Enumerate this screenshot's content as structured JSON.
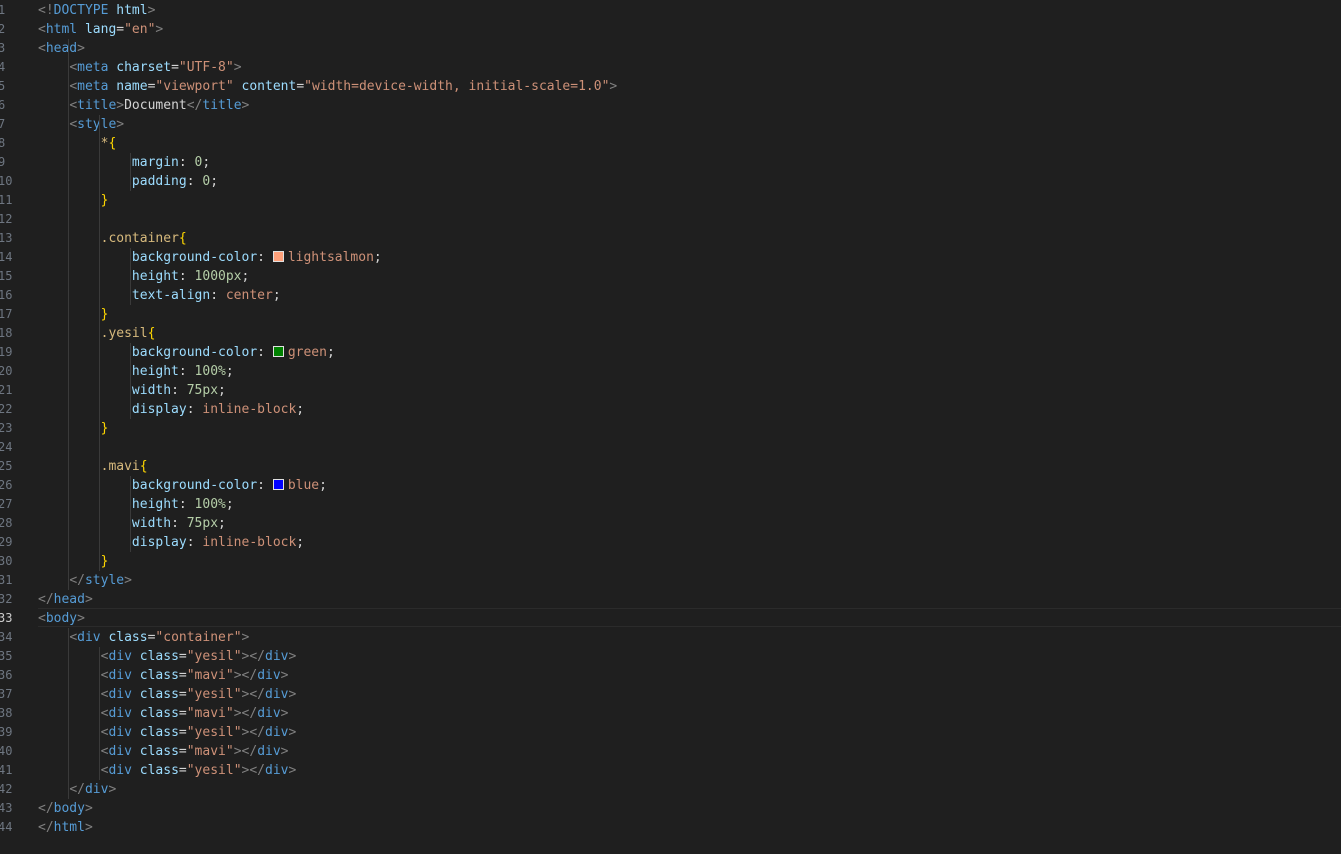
{
  "editor": {
    "active_line": 33,
    "line_numbers": [
      "1",
      "2",
      "3",
      "4",
      "5",
      "6",
      "7",
      "8",
      "9",
      "10",
      "11",
      "12",
      "13",
      "14",
      "15",
      "16",
      "17",
      "18",
      "19",
      "20",
      "21",
      "22",
      "23",
      "24",
      "25",
      "26",
      "27",
      "28",
      "29",
      "30",
      "31",
      "32",
      "33",
      "34",
      "35",
      "36",
      "37",
      "38",
      "39",
      "40",
      "41",
      "42",
      "43",
      "44"
    ],
    "swatch_colors": {
      "lightsalmon": "#ffa07a",
      "green": "#008000",
      "blue": "#0000ff"
    },
    "lines": [
      [
        [
          "punct",
          "<!"
        ],
        [
          "tag",
          "DOCTYPE"
        ],
        [
          "plain",
          " "
        ],
        [
          "attr",
          "html"
        ],
        [
          "punct",
          ">"
        ]
      ],
      [
        [
          "punct",
          "<"
        ],
        [
          "tag",
          "html"
        ],
        [
          "plain",
          " "
        ],
        [
          "attr",
          "lang"
        ],
        [
          "plain",
          "="
        ],
        [
          "str",
          "\"en\""
        ],
        [
          "punct",
          ">"
        ]
      ],
      [
        [
          "punct",
          "<"
        ],
        [
          "tag",
          "head"
        ],
        [
          "punct",
          ">"
        ]
      ],
      [
        [
          "plain",
          "    "
        ],
        [
          "punct",
          "<"
        ],
        [
          "tag",
          "meta"
        ],
        [
          "plain",
          " "
        ],
        [
          "attr",
          "charset"
        ],
        [
          "plain",
          "="
        ],
        [
          "str",
          "\"UTF-8\""
        ],
        [
          "punct",
          ">"
        ]
      ],
      [
        [
          "plain",
          "    "
        ],
        [
          "punct",
          "<"
        ],
        [
          "tag",
          "meta"
        ],
        [
          "plain",
          " "
        ],
        [
          "attr",
          "name"
        ],
        [
          "plain",
          "="
        ],
        [
          "str",
          "\"viewport\""
        ],
        [
          "plain",
          " "
        ],
        [
          "attr",
          "content"
        ],
        [
          "plain",
          "="
        ],
        [
          "str",
          "\"width=device-width, initial-scale=1.0\""
        ],
        [
          "punct",
          ">"
        ]
      ],
      [
        [
          "plain",
          "    "
        ],
        [
          "punct",
          "<"
        ],
        [
          "tag",
          "title"
        ],
        [
          "punct",
          ">"
        ],
        [
          "text",
          "Document"
        ],
        [
          "punct",
          "</"
        ],
        [
          "tag",
          "title"
        ],
        [
          "punct",
          ">"
        ]
      ],
      [
        [
          "plain",
          "    "
        ],
        [
          "punct",
          "<"
        ],
        [
          "tag",
          "style"
        ],
        [
          "punct",
          ">"
        ]
      ],
      [
        [
          "plain",
          "        "
        ],
        [
          "sel",
          "*"
        ],
        [
          "brace",
          "{"
        ]
      ],
      [
        [
          "plain",
          "            "
        ],
        [
          "prop",
          "margin"
        ],
        [
          "plain",
          ": "
        ],
        [
          "num",
          "0"
        ],
        [
          "plain",
          ";"
        ]
      ],
      [
        [
          "plain",
          "            "
        ],
        [
          "prop",
          "padding"
        ],
        [
          "plain",
          ": "
        ],
        [
          "num",
          "0"
        ],
        [
          "plain",
          ";"
        ]
      ],
      [
        [
          "plain",
          "        "
        ],
        [
          "brace",
          "}"
        ]
      ],
      [],
      [
        [
          "plain",
          "        "
        ],
        [
          "sel",
          ".container"
        ],
        [
          "brace",
          "{"
        ]
      ],
      [
        [
          "plain",
          "            "
        ],
        [
          "prop",
          "background-color"
        ],
        [
          "plain",
          ": "
        ],
        [
          "swatch",
          "lightsalmon"
        ],
        [
          "val",
          "lightsalmon"
        ],
        [
          "plain",
          ";"
        ]
      ],
      [
        [
          "plain",
          "            "
        ],
        [
          "prop",
          "height"
        ],
        [
          "plain",
          ": "
        ],
        [
          "num",
          "1000px"
        ],
        [
          "plain",
          ";"
        ]
      ],
      [
        [
          "plain",
          "            "
        ],
        [
          "prop",
          "text-align"
        ],
        [
          "plain",
          ": "
        ],
        [
          "val",
          "center"
        ],
        [
          "plain",
          ";"
        ]
      ],
      [
        [
          "plain",
          "        "
        ],
        [
          "brace",
          "}"
        ]
      ],
      [
        [
          "plain",
          "        "
        ],
        [
          "sel",
          ".yesil"
        ],
        [
          "brace",
          "{"
        ]
      ],
      [
        [
          "plain",
          "            "
        ],
        [
          "prop",
          "background-color"
        ],
        [
          "plain",
          ": "
        ],
        [
          "swatch",
          "green"
        ],
        [
          "val",
          "green"
        ],
        [
          "plain",
          ";"
        ]
      ],
      [
        [
          "plain",
          "            "
        ],
        [
          "prop",
          "height"
        ],
        [
          "plain",
          ": "
        ],
        [
          "num",
          "100%"
        ],
        [
          "plain",
          ";"
        ]
      ],
      [
        [
          "plain",
          "            "
        ],
        [
          "prop",
          "width"
        ],
        [
          "plain",
          ": "
        ],
        [
          "num",
          "75px"
        ],
        [
          "plain",
          ";"
        ]
      ],
      [
        [
          "plain",
          "            "
        ],
        [
          "prop",
          "display"
        ],
        [
          "plain",
          ": "
        ],
        [
          "val",
          "inline-block"
        ],
        [
          "plain",
          ";"
        ]
      ],
      [
        [
          "plain",
          "        "
        ],
        [
          "brace",
          "}"
        ]
      ],
      [],
      [
        [
          "plain",
          "        "
        ],
        [
          "sel",
          ".mavi"
        ],
        [
          "brace",
          "{"
        ]
      ],
      [
        [
          "plain",
          "            "
        ],
        [
          "prop",
          "background-color"
        ],
        [
          "plain",
          ": "
        ],
        [
          "swatch",
          "blue"
        ],
        [
          "val",
          "blue"
        ],
        [
          "plain",
          ";"
        ]
      ],
      [
        [
          "plain",
          "            "
        ],
        [
          "prop",
          "height"
        ],
        [
          "plain",
          ": "
        ],
        [
          "num",
          "100%"
        ],
        [
          "plain",
          ";"
        ]
      ],
      [
        [
          "plain",
          "            "
        ],
        [
          "prop",
          "width"
        ],
        [
          "plain",
          ": "
        ],
        [
          "num",
          "75px"
        ],
        [
          "plain",
          ";"
        ]
      ],
      [
        [
          "plain",
          "            "
        ],
        [
          "prop",
          "display"
        ],
        [
          "plain",
          ": "
        ],
        [
          "val",
          "inline-block"
        ],
        [
          "plain",
          ";"
        ]
      ],
      [
        [
          "plain",
          "        "
        ],
        [
          "brace",
          "}"
        ]
      ],
      [
        [
          "plain",
          "    "
        ],
        [
          "punct",
          "</"
        ],
        [
          "tag",
          "style"
        ],
        [
          "punct",
          ">"
        ]
      ],
      [
        [
          "punct",
          "</"
        ],
        [
          "tag",
          "head"
        ],
        [
          "punct",
          ">"
        ]
      ],
      [
        [
          "punct",
          "<"
        ],
        [
          "tag",
          "body"
        ],
        [
          "punct",
          ">"
        ]
      ],
      [
        [
          "plain",
          "    "
        ],
        [
          "punct",
          "<"
        ],
        [
          "tag",
          "div"
        ],
        [
          "plain",
          " "
        ],
        [
          "attr",
          "class"
        ],
        [
          "plain",
          "="
        ],
        [
          "str",
          "\"container\""
        ],
        [
          "punct",
          ">"
        ]
      ],
      [
        [
          "plain",
          "        "
        ],
        [
          "punct",
          "<"
        ],
        [
          "tag",
          "div"
        ],
        [
          "plain",
          " "
        ],
        [
          "attr",
          "class"
        ],
        [
          "plain",
          "="
        ],
        [
          "str",
          "\"yesil\""
        ],
        [
          "punct",
          "></"
        ],
        [
          "tag",
          "div"
        ],
        [
          "punct",
          ">"
        ]
      ],
      [
        [
          "plain",
          "        "
        ],
        [
          "punct",
          "<"
        ],
        [
          "tag",
          "div"
        ],
        [
          "plain",
          " "
        ],
        [
          "attr",
          "class"
        ],
        [
          "plain",
          "="
        ],
        [
          "str",
          "\"mavi\""
        ],
        [
          "punct",
          "></"
        ],
        [
          "tag",
          "div"
        ],
        [
          "punct",
          ">"
        ]
      ],
      [
        [
          "plain",
          "        "
        ],
        [
          "punct",
          "<"
        ],
        [
          "tag",
          "div"
        ],
        [
          "plain",
          " "
        ],
        [
          "attr",
          "class"
        ],
        [
          "plain",
          "="
        ],
        [
          "str",
          "\"yesil\""
        ],
        [
          "punct",
          "></"
        ],
        [
          "tag",
          "div"
        ],
        [
          "punct",
          ">"
        ]
      ],
      [
        [
          "plain",
          "        "
        ],
        [
          "punct",
          "<"
        ],
        [
          "tag",
          "div"
        ],
        [
          "plain",
          " "
        ],
        [
          "attr",
          "class"
        ],
        [
          "plain",
          "="
        ],
        [
          "str",
          "\"mavi\""
        ],
        [
          "punct",
          "></"
        ],
        [
          "tag",
          "div"
        ],
        [
          "punct",
          ">"
        ]
      ],
      [
        [
          "plain",
          "        "
        ],
        [
          "punct",
          "<"
        ],
        [
          "tag",
          "div"
        ],
        [
          "plain",
          " "
        ],
        [
          "attr",
          "class"
        ],
        [
          "plain",
          "="
        ],
        [
          "str",
          "\"yesil\""
        ],
        [
          "punct",
          "></"
        ],
        [
          "tag",
          "div"
        ],
        [
          "punct",
          ">"
        ]
      ],
      [
        [
          "plain",
          "        "
        ],
        [
          "punct",
          "<"
        ],
        [
          "tag",
          "div"
        ],
        [
          "plain",
          " "
        ],
        [
          "attr",
          "class"
        ],
        [
          "plain",
          "="
        ],
        [
          "str",
          "\"mavi\""
        ],
        [
          "punct",
          "></"
        ],
        [
          "tag",
          "div"
        ],
        [
          "punct",
          ">"
        ]
      ],
      [
        [
          "plain",
          "        "
        ],
        [
          "punct",
          "<"
        ],
        [
          "tag",
          "div"
        ],
        [
          "plain",
          " "
        ],
        [
          "attr",
          "class"
        ],
        [
          "plain",
          "="
        ],
        [
          "str",
          "\"yesil\""
        ],
        [
          "punct",
          "></"
        ],
        [
          "tag",
          "div"
        ],
        [
          "punct",
          ">"
        ]
      ],
      [
        [
          "plain",
          "    "
        ],
        [
          "punct",
          "</"
        ],
        [
          "tag",
          "div"
        ],
        [
          "punct",
          ">"
        ]
      ],
      [
        [
          "punct",
          "</"
        ],
        [
          "tag",
          "body"
        ],
        [
          "punct",
          ">"
        ]
      ],
      [
        [
          "punct",
          "</"
        ],
        [
          "tag",
          "html"
        ],
        [
          "punct",
          ">"
        ]
      ]
    ]
  }
}
